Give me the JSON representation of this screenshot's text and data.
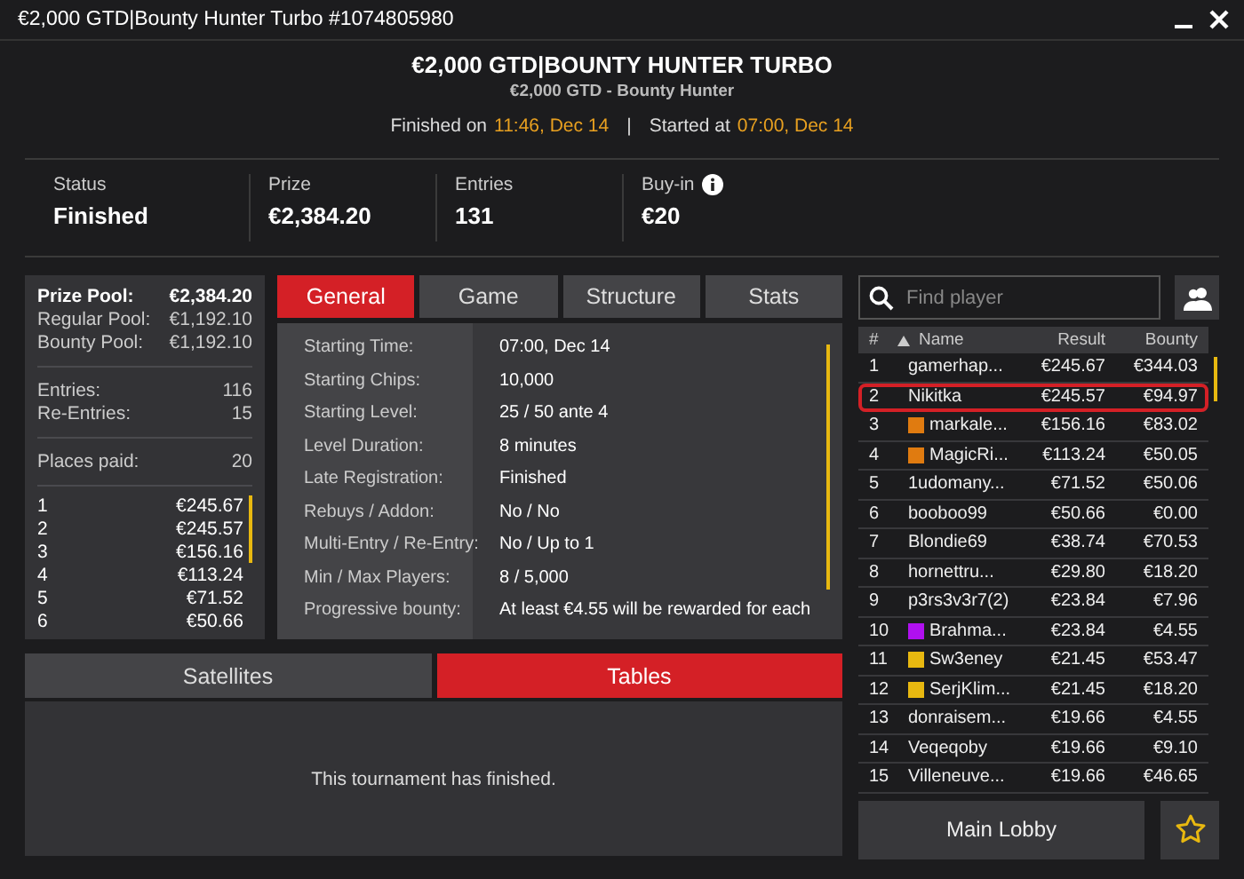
{
  "title_bar": {
    "title": "€2,000 GTD|Bounty Hunter Turbo #1074805980"
  },
  "header": {
    "title": "€2,000 GTD|BOUNTY HUNTER TURBO",
    "subtitle": "€2,000 GTD - Bounty Hunter",
    "finished_label": "Finished on",
    "finished_time": "11:46, Dec 14",
    "separator": "|",
    "started_label": "Started at",
    "started_time": "07:00, Dec 14"
  },
  "stats": [
    {
      "label": "Status",
      "value": "Finished",
      "info": false
    },
    {
      "label": "Prize",
      "value": "€2,384.20",
      "info": false
    },
    {
      "label": "Entries",
      "value": "131",
      "info": false
    },
    {
      "label": "Buy-in",
      "value": "€20",
      "info": true
    }
  ],
  "prize_panel": {
    "groups": [
      [
        {
          "label": "Prize Pool:",
          "value": "€2,384.20",
          "kind": "total"
        },
        {
          "label": "Regular Pool:",
          "value": "€1,192.10",
          "kind": "line"
        },
        {
          "label": "Bounty Pool:",
          "value": "€1,192.10",
          "kind": "line"
        }
      ],
      [
        {
          "label": "Entries:",
          "value": "116",
          "kind": "line"
        },
        {
          "label": "Re-Entries:",
          "value": "15",
          "kind": "line"
        }
      ],
      [
        {
          "label": "Places paid:",
          "value": "20",
          "kind": "line"
        }
      ]
    ],
    "payouts": [
      {
        "place": "1",
        "amount": "€245.67"
      },
      {
        "place": "2",
        "amount": "€245.57"
      },
      {
        "place": "3",
        "amount": "€156.16"
      },
      {
        "place": "4",
        "amount": "€113.24"
      },
      {
        "place": "5",
        "amount": "€71.52"
      },
      {
        "place": "6",
        "amount": "€50.66"
      }
    ]
  },
  "info_tabs": [
    {
      "label": "General",
      "selected": true
    },
    {
      "label": "Game",
      "selected": false
    },
    {
      "label": "Structure",
      "selected": false
    },
    {
      "label": "Stats",
      "selected": false
    }
  ],
  "info_rows": [
    {
      "label": "Starting Time:",
      "value": "07:00, Dec 14"
    },
    {
      "label": "Starting Chips:",
      "value": "10,000"
    },
    {
      "label": "Starting Level:",
      "value": "25 / 50 ante 4"
    },
    {
      "label": "Level Duration:",
      "value": "8 minutes"
    },
    {
      "label": "Late Registration:",
      "value": "Finished"
    },
    {
      "label": "Rebuys / Addon:",
      "value": "No / No"
    },
    {
      "label": "Multi-Entry / Re-Entry:",
      "value": "No / Up to 1"
    },
    {
      "label": "Min / Max Players:",
      "value": "8 / 5,000"
    },
    {
      "label": "Progressive bounty:",
      "value": "At least €4.55 will be rewarded for each"
    }
  ],
  "bottom_tabs": [
    {
      "label": "Satellites",
      "selected": false
    },
    {
      "label": "Tables",
      "selected": true
    }
  ],
  "bottom_message": "This tournament has finished.",
  "search": {
    "placeholder": "Find player"
  },
  "players": {
    "columns": [
      "#",
      "Name",
      "Result",
      "Bounty"
    ],
    "rows": [
      {
        "rank": "1",
        "name": "gamerhap...",
        "result": "€245.67",
        "bounty": "€344.03",
        "selected": false
      },
      {
        "rank": "2",
        "name": "Nikitka",
        "result": "€245.57",
        "bounty": "€94.97",
        "selected": true
      },
      {
        "rank": "3",
        "name": "markale...",
        "result": "€156.16",
        "bounty": "€83.02",
        "selected": false,
        "color": "#e07b10"
      },
      {
        "rank": "4",
        "name": "MagicRi...",
        "result": "€113.24",
        "bounty": "€50.05",
        "selected": false,
        "color": "#e07b10"
      },
      {
        "rank": "5",
        "name": "1udomany...",
        "result": "€71.52",
        "bounty": "€50.06",
        "selected": false
      },
      {
        "rank": "6",
        "name": "booboo99",
        "result": "€50.66",
        "bounty": "€0.00",
        "selected": false
      },
      {
        "rank": "7",
        "name": "Blondie69",
        "result": "€38.74",
        "bounty": "€70.53",
        "selected": false
      },
      {
        "rank": "8",
        "name": "hornettru...",
        "result": "€29.80",
        "bounty": "€18.20",
        "selected": false
      },
      {
        "rank": "9",
        "name": "p3rs3v3r7(2)",
        "result": "€23.84",
        "bounty": "€7.96",
        "selected": false
      },
      {
        "rank": "10",
        "name": "Brahma...",
        "result": "€23.84",
        "bounty": "€4.55",
        "selected": false,
        "color": "#b010f0"
      },
      {
        "rank": "11",
        "name": "Sw3eney",
        "result": "€21.45",
        "bounty": "€53.47",
        "selected": false,
        "color": "#e8b810"
      },
      {
        "rank": "12",
        "name": "SerjKlim...",
        "result": "€21.45",
        "bounty": "€18.20",
        "selected": false,
        "color": "#e8b810"
      },
      {
        "rank": "13",
        "name": "donraisem...",
        "result": "€19.66",
        "bounty": "€4.55",
        "selected": false
      },
      {
        "rank": "14",
        "name": "Veqeqoby",
        "result": "€19.66",
        "bounty": "€9.10",
        "selected": false
      },
      {
        "rank": "15",
        "name": "Villeneuve...",
        "result": "€19.66",
        "bounty": "€46.65",
        "selected": false
      }
    ]
  },
  "main_lobby_button": "Main Lobby"
}
